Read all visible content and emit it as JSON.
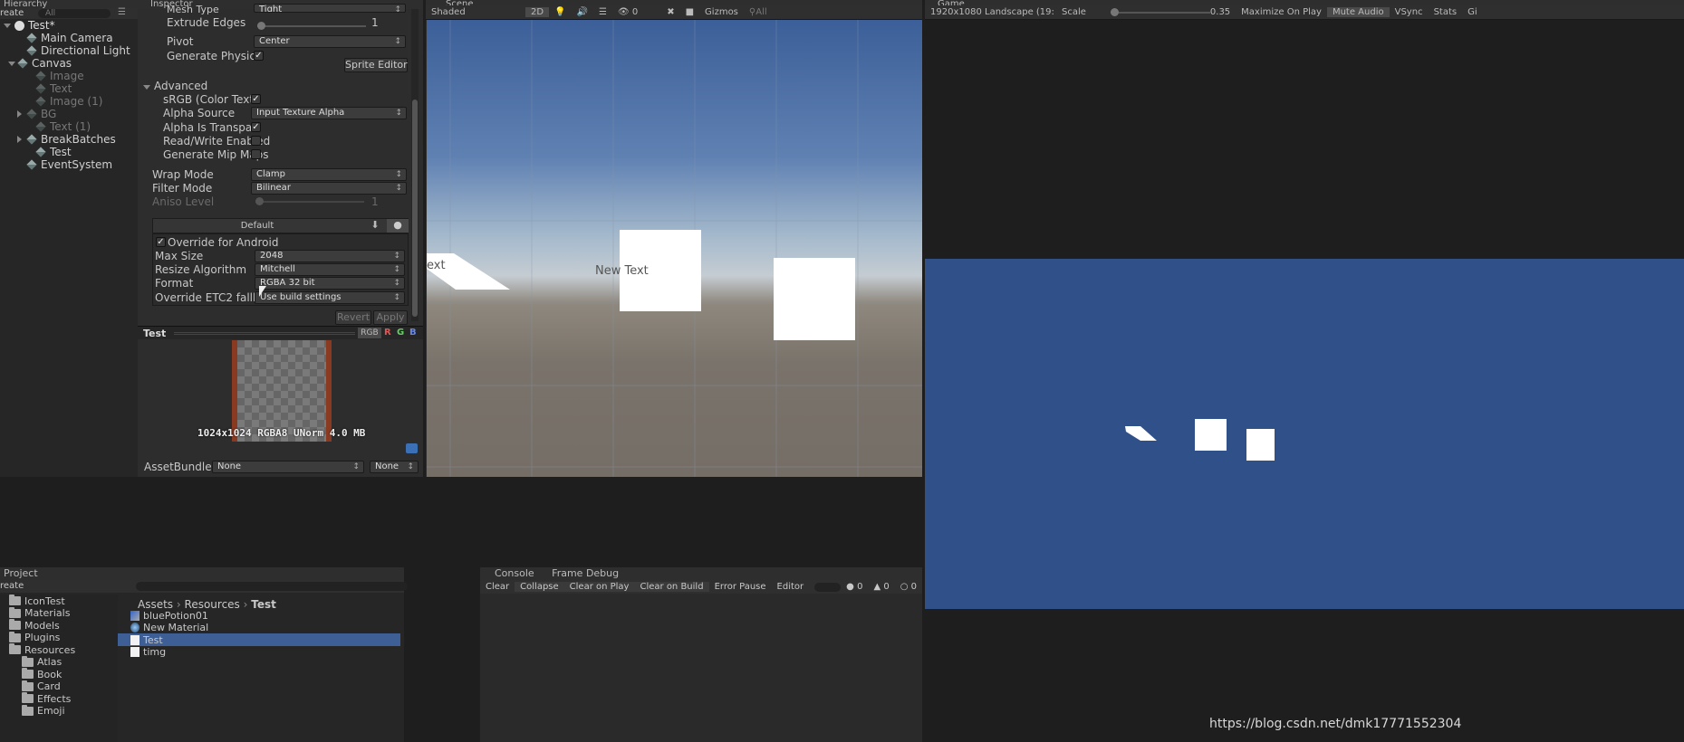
{
  "hierarchy": {
    "tab": "Hierarchy",
    "create_label": "reate",
    "search_placeholder": "All",
    "scene_name": "Test*",
    "items": [
      {
        "label": "Main Camera",
        "dim": false
      },
      {
        "label": "Directional Light",
        "dim": false
      },
      {
        "label": "Canvas",
        "dim": false
      },
      {
        "label": "Image",
        "dim": true
      },
      {
        "label": "Text",
        "dim": true
      },
      {
        "label": "Image (1)",
        "dim": true
      },
      {
        "label": "BG",
        "dim": true
      },
      {
        "label": "Text (1)",
        "dim": true
      },
      {
        "label": "BreakBatches",
        "dim": false
      },
      {
        "label": "Test",
        "dim": false
      },
      {
        "label": "EventSystem",
        "dim": false
      }
    ]
  },
  "inspector": {
    "tab": "Inspector",
    "mesh_type_label": "Mesh Type",
    "mesh_type_value": "Tight",
    "extrude_edges_label": "Extrude Edges",
    "extrude_edges_value": "1",
    "pivot_label": "Pivot",
    "pivot_value": "Center",
    "gen_physics_label": "Generate Physics Sh",
    "sprite_editor_label": "Sprite Editor",
    "advanced_label": "Advanced",
    "srgb_label": "sRGB (Color Texture",
    "alpha_source_label": "Alpha Source",
    "alpha_source_value": "Input Texture Alpha",
    "alpha_transp_label": "Alpha Is Transparen",
    "rw_label": "Read/Write Enabled",
    "mipmaps_label": "Generate Mip Maps",
    "wrap_label": "Wrap Mode",
    "wrap_value": "Clamp",
    "filter_label": "Filter Mode",
    "filter_value": "Bilinear",
    "aniso_label": "Aniso Level",
    "aniso_value": "1",
    "platform_default": "Default",
    "override_label": "Override for Android",
    "max_size_label": "Max Size",
    "max_size_value": "2048",
    "resize_label": "Resize Algorithm",
    "resize_value": "Mitchell",
    "format_label": "Format",
    "format_value": "RGBA 32 bit",
    "etc2_label": "Override ETC2 fallback",
    "etc2_value": "Use build settings",
    "revert_label": "Revert",
    "apply_label": "Apply",
    "preview_title": "Test",
    "channels": [
      "RGB",
      "R",
      "G",
      "B"
    ],
    "preview_info": "1024x1024  RGBA8 UNorm   4.0 MB",
    "assetbundle_label": "AssetBundle",
    "assetbundle_value": "None",
    "assetbundle_variant": "None"
  },
  "scene": {
    "tab": "Scene",
    "shading": "Shaded",
    "mode_2d": "2D",
    "effects_count": "0",
    "gizmos": "Gizmos",
    "search_placeholder": "All",
    "new_text_label": "New Text",
    "partial_text": "ext"
  },
  "game": {
    "tab": "Game",
    "resolution": "1920x1080 Landscape (19:",
    "scale_label": "Scale",
    "scale_value": "0.35",
    "maximize": "Maximize On Play",
    "mute": "Mute Audio",
    "vsync": "VSync",
    "stats": "Stats",
    "gizmos": "Gi"
  },
  "project": {
    "tab": "Project",
    "create_label": "reate",
    "folders": [
      {
        "label": "IconTest",
        "indent": 1
      },
      {
        "label": "Materials",
        "indent": 1
      },
      {
        "label": "Models",
        "indent": 1
      },
      {
        "label": "Plugins",
        "indent": 1
      },
      {
        "label": "Resources",
        "indent": 1
      },
      {
        "label": "Atlas",
        "indent": 2
      },
      {
        "label": "Book",
        "indent": 2
      },
      {
        "label": "Card",
        "indent": 2
      },
      {
        "label": "Effects",
        "indent": 2
      },
      {
        "label": "Emoji",
        "indent": 2
      }
    ],
    "breadcrumb": [
      "Assets",
      "Resources",
      "Test"
    ],
    "assets": [
      {
        "label": "bluePotion01",
        "selected": false
      },
      {
        "label": "New Material",
        "selected": false
      },
      {
        "label": "Test",
        "selected": true
      },
      {
        "label": "timg",
        "selected": false
      }
    ]
  },
  "console": {
    "tab": "Console",
    "tab2": "Frame Debug",
    "buttons": [
      "Clear",
      "Collapse",
      "Clear on Play",
      "Clear on Build",
      "Error Pause",
      "Editor"
    ],
    "errors": "0",
    "warnings": "0",
    "logs": "0"
  },
  "watermark": "https://blog.csdn.net/dmk17771552304",
  "colors": {
    "selection": "#3e5f96",
    "game_bg": "#2f5089",
    "panel_bg": "#2a2a2a"
  }
}
